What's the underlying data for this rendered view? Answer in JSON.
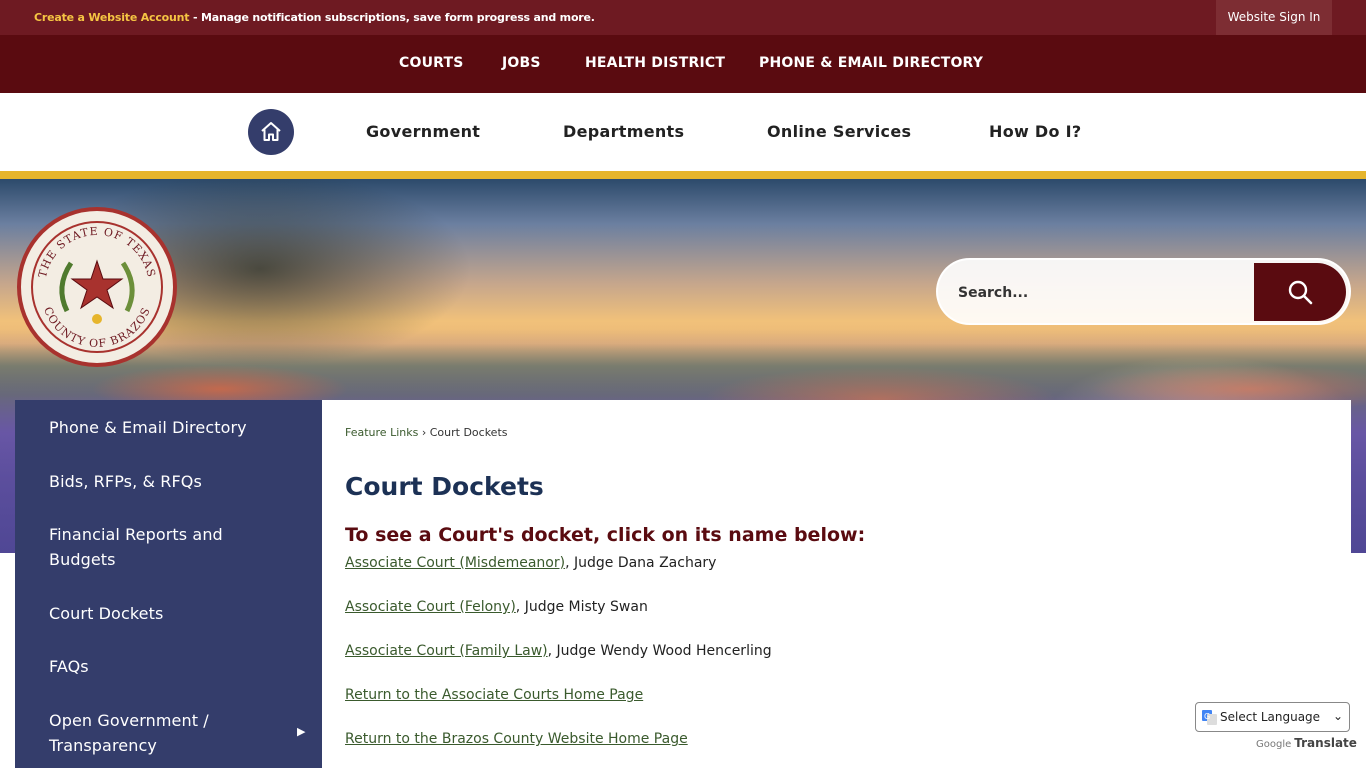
{
  "topbar": {
    "create_link": "Create a Website Account",
    "notice_text": " - Manage notification subscriptions, save form progress and more.",
    "sign_in": "Website Sign In"
  },
  "featured_nav": [
    "COURTS",
    "JOBS",
    "HEALTH DISTRICT",
    "PHONE & EMAIL DIRECTORY"
  ],
  "main_nav": [
    "Government",
    "Departments",
    "Online Services",
    "How Do I?"
  ],
  "seal": {
    "top_text": "THE STATE OF TEXAS",
    "bottom_text": "COUNTY OF BRAZOS"
  },
  "search": {
    "placeholder": "Search..."
  },
  "side_menu": [
    "Phone & Email Directory",
    "Bids, RFPs, & RFQs",
    "Financial Reports and Budgets",
    "Court Dockets",
    "FAQs",
    "Open Government / Transparency"
  ],
  "breadcrumb": {
    "parent": "Feature Links",
    "separator": " › ",
    "current": "Court Dockets"
  },
  "page_title": "Court Dockets",
  "subhead": "To see a Court's docket, click on its name below:",
  "courts": [
    {
      "link": "Associate Court (Misdemeanor)",
      "judge": ", Judge Dana Zachary"
    },
    {
      "link": "Associate Court (Felony)",
      "judge": ", Judge Misty Swan"
    },
    {
      "link": "Associate Court (Family Law)",
      "judge": ", Judge Wendy Wood Hencerling"
    }
  ],
  "return_links": [
    "Return to the Associate Courts Home Page",
    "Return to the Brazos County Website Home Page"
  ],
  "translate": {
    "select_label": "Select Language",
    "powered_google": "Google",
    "powered_translate": "Translate"
  },
  "colors": {
    "topbar": "#6e1a22",
    "featured_nav": "#5a0b10",
    "side_menu": "#343d6b",
    "gold_accent": "#e6b52c",
    "title": "#1c3155"
  }
}
